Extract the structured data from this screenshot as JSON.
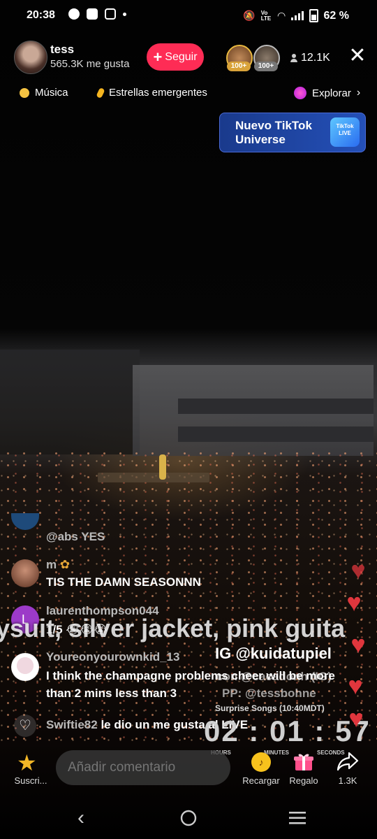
{
  "status_bar": {
    "time": "20:38",
    "battery_percent": "62 %",
    "volte": "Vo LTE"
  },
  "host": {
    "name": "tess",
    "likes": "565.3K me gusta",
    "follow_label": "Seguir",
    "viewers": "12.1K"
  },
  "top_gifters": [
    {
      "badge": "100+"
    },
    {
      "badge": "100+"
    }
  ],
  "categories": {
    "music": "Música",
    "rising_stars": "Estrellas emergentes",
    "explore": "Explorar"
  },
  "banner": {
    "line1": "Nuevo TikTok",
    "line2": "Universe",
    "logo_text": "TikTok LIVE"
  },
  "comments": [
    {
      "user": "@abs YES",
      "text": ""
    },
    {
      "user": "m",
      "text": "TIS THE DAMN SEASONNN"
    },
    {
      "user": "laurenthompson044",
      "text": "1/5 😭😭😭",
      "avatar_letter": "L"
    },
    {
      "user": "Youreonyourownkid_13",
      "text": "I think the champagne problems cheer will be more than 2 mins less than 3"
    }
  ],
  "like_notice": {
    "user": "Swiftie82",
    "text": "le dio un me gusta al LIVE"
  },
  "overlay": {
    "caption": "ysuit, silver jacket, pink guita",
    "ig": "IG @kuidatupiel",
    "line_faded_1": "con @cacadonh (IG)",
    "line_faded_2": "PP: @tessbohne",
    "surprise": "Surprise Songs (10:40MDT)",
    "timer": "02 : 01 : 57",
    "labels": [
      "HOURS",
      "MINUTES",
      "SECONDS"
    ]
  },
  "bottom_bar": {
    "subscribe": "Suscri...",
    "comment_placeholder": "Añadir comentario",
    "recharge": "Recargar",
    "gift": "Regalo",
    "share_count": "1.3K"
  },
  "colors": {
    "follow": "#fe2c55",
    "heart": "#e0363d",
    "banner": "#2450b8"
  }
}
